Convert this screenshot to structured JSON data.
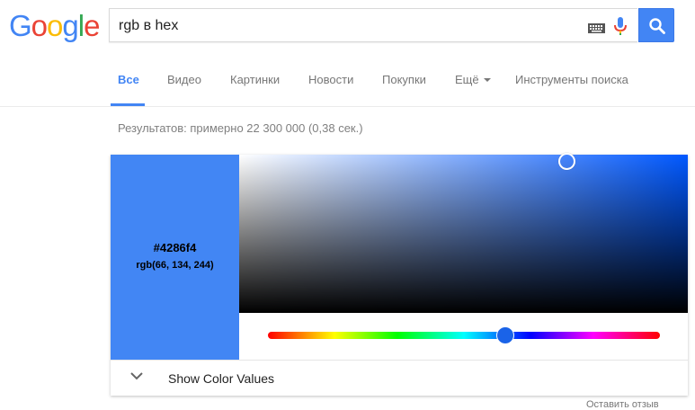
{
  "logo": {
    "letters": [
      "G",
      "o",
      "o",
      "g",
      "l",
      "e"
    ],
    "colors": [
      "#4285f4",
      "#ea4335",
      "#fbbc05",
      "#4285f4",
      "#34a853",
      "#ea4335"
    ]
  },
  "search": {
    "query": "rgb в hex",
    "button_icon": "search-icon",
    "keyboard_icon": "keyboard-icon",
    "mic_icon": "mic-icon"
  },
  "tabs": [
    {
      "label": "Все",
      "active": true
    },
    {
      "label": "Видео"
    },
    {
      "label": "Картинки"
    },
    {
      "label": "Новости"
    },
    {
      "label": "Покупки"
    },
    {
      "label": "Ещё"
    },
    {
      "label": "Инструменты поиска"
    }
  ],
  "stats": "Результатов: примерно 22 300 000 (0,38 сек.)",
  "color_picker": {
    "hex": "#4286f4",
    "rgb": "rgb(66, 134, 244)",
    "expander_label": "Show Color Values",
    "swatch_color": "#4286f4",
    "hue_fraction": 0.6
  },
  "footer": {
    "text": "Оставить отзыв"
  },
  "accent_color": "#4285f4"
}
